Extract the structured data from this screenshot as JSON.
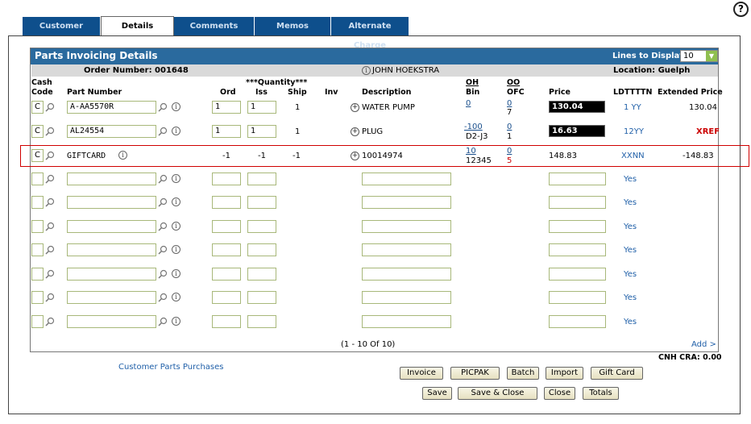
{
  "help": "?",
  "tabs": [
    "Customer",
    "Details",
    "Comments",
    "Memos",
    "Alternate Charge"
  ],
  "panel": {
    "title": "Parts Invoicing Details",
    "lines_label": "Lines to Display:",
    "lines_value": "10",
    "order_number": "Order Number: 001648",
    "customer": "JOHN HOEKSTRA",
    "location": "Location: Guelph"
  },
  "headers": {
    "cash": "Cash",
    "code": "Code",
    "part_number": "Part Number",
    "quantity": "***Quantity***",
    "ord": "Ord",
    "iss": "Iss",
    "ship": "Ship",
    "inv": "Inv",
    "description": "Description",
    "oh": "OH",
    "bin": "Bin",
    "oo": "OO",
    "ofc": "OFC",
    "price": "Price",
    "ldtttn": "LDTTTTN",
    "extended": "Extended Price"
  },
  "rows": [
    {
      "code": "C",
      "part": "A-AA5570R",
      "ord": "1",
      "iss": "1",
      "ship": "1",
      "desc": "WATER PUMP",
      "oh": "0",
      "bin": "",
      "oo": "0",
      "ofc": "7",
      "price": "130.04",
      "ld": "1 YY",
      "ext": "130.04"
    },
    {
      "code": "C",
      "part": "AL24554",
      "ord": "1",
      "iss": "1",
      "ship": "1",
      "desc": "PLUG",
      "oh": "-100",
      "bin": "D2-J3",
      "oo": "0",
      "ofc": "1",
      "price": "16.63",
      "ld": "12YY",
      "ext": "XREF"
    },
    {
      "code": "C",
      "part": "GIFTCARD",
      "ord": "-1",
      "iss": "-1",
      "ship": "-1",
      "desc": "10014974",
      "oh": "10",
      "bin": "12345",
      "oo": "0",
      "ofc": "5",
      "price": "148.83",
      "ld": "XXNN",
      "ext": "-148.83"
    }
  ],
  "empty_ld": "Yes",
  "pagination": "(1  -  10  Of  10)",
  "add_link": "Add >",
  "cnh_cra": "CNH CRA:  0.00",
  "customer_parts_link": "Customer Parts Purchases",
  "buttons_row1": [
    "Invoice",
    "PICPAK",
    "Batch",
    "Import",
    "Gift Card"
  ],
  "buttons_row2": [
    "Save",
    "Save & Close",
    "Close",
    "Totals"
  ]
}
